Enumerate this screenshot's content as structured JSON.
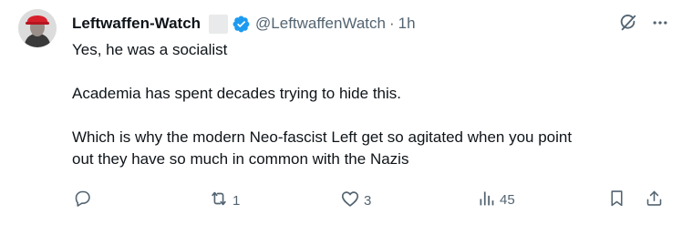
{
  "tweet": {
    "display_name": "Leftwaffen-Watch",
    "handle": "@LeftwaffenWatch",
    "separator": "·",
    "time": "1h",
    "lines": [
      "Yes, he was a socialist",
      "",
      "Academia has spent decades trying to hide this.",
      "",
      "Which is why the modern Neo-fascist Left get so agitated when you point",
      "out they have so much in common with the Nazis"
    ]
  },
  "stats": {
    "replies": "",
    "reposts": "1",
    "likes": "3",
    "views": "45"
  },
  "colors": {
    "text": "#0f1419",
    "muted": "#536471",
    "verified": "#1d9bf0"
  },
  "icons": [
    "grok-icon",
    "more-icon",
    "reply-icon",
    "repost-icon",
    "like-icon",
    "views-icon",
    "bookmark-icon",
    "share-icon"
  ]
}
